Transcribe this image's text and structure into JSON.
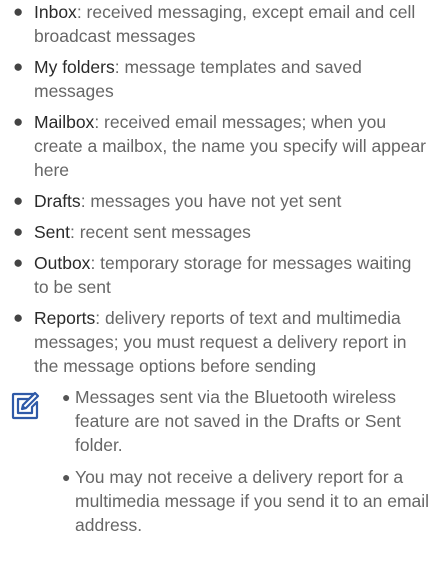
{
  "folders": [
    {
      "term": "Inbox",
      "desc": ": received messaging, except email and cell broadcast messages"
    },
    {
      "term": "My folders",
      "desc": ": message templates and saved messages"
    },
    {
      "term": "Mailbox",
      "desc": ": received email messages; when you create a mailbox, the name you specify will appear here"
    },
    {
      "term": "Drafts",
      "desc": ": messages you have not yet sent"
    },
    {
      "term": "Sent",
      "desc": ": recent sent messages"
    },
    {
      "term": "Outbox",
      "desc": ": temporary storage for messages waiting to be sent"
    },
    {
      "term": "Reports",
      "desc": ": delivery reports of text and multimedia messages; you must request a delivery report in the message options before sending"
    }
  ],
  "note": {
    "icon": "note-pencil-icon",
    "items": [
      "Messages sent via the Bluetooth wireless feature are not saved in the Drafts or Sent folder.",
      "You may not receive a delivery report for a multimedia message if you send it to an email address."
    ]
  }
}
